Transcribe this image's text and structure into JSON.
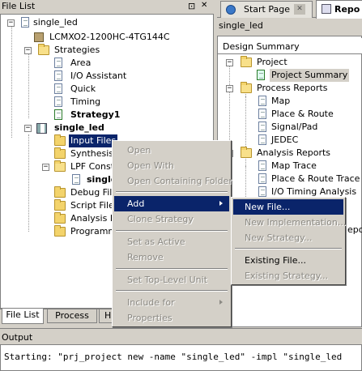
{
  "file_list": {
    "title": "File List",
    "pin_glyph": "⊡",
    "close_glyph": "✕",
    "project": "single_led",
    "device": "LCMXO2-1200HC-4TG144C",
    "strategies_label": "Strategies",
    "strategies": [
      "Area",
      "I/O Assistant",
      "Quick",
      "Timing",
      "Strategy1"
    ],
    "implementation": "single_led",
    "impl_items": [
      "Input Files",
      "Synthesis C",
      "LPF Constr",
      "Debug File",
      "Script Files",
      "Analysis Fi",
      "Programmi"
    ],
    "lpf_child": "single",
    "bottom_tabs": [
      "File List",
      "Process",
      "H"
    ]
  },
  "right_panel": {
    "tabs": [
      "Start Page",
      "Repo"
    ],
    "tab_close": "✕",
    "path": "single_led",
    "header": "Design Summary",
    "tree": [
      {
        "label": "Project",
        "type": "folder"
      },
      {
        "label": "Project Summary",
        "type": "doc"
      },
      {
        "label": "Process Reports",
        "type": "folder"
      },
      {
        "label": "Map",
        "type": "doc"
      },
      {
        "label": "Place & Route",
        "type": "doc"
      },
      {
        "label": "Signal/Pad",
        "type": "doc"
      },
      {
        "label": "JEDEC",
        "type": "doc"
      },
      {
        "label": "Analysis Reports",
        "type": "folder"
      },
      {
        "label": "Map Trace",
        "type": "doc"
      },
      {
        "label": "Place & Route Trace",
        "type": "doc"
      },
      {
        "label": "I/O Timing Analysis",
        "type": "doc"
      }
    ],
    "clipped_text": "epo"
  },
  "context_menu": {
    "items": [
      "Open",
      "Open With",
      "Open Containing Folder",
      "Add",
      "Clone Strategy",
      "Set as Active",
      "Remove",
      "Set Top-Level Unit",
      "Include for",
      "Properties"
    ]
  },
  "submenu": {
    "items": [
      "New File...",
      "New Implementation...",
      "New Strategy...",
      "Existing File...",
      "Existing Strategy..."
    ]
  },
  "output": {
    "title": "Output",
    "text": "Starting: \"prj_project new -name \"single_led\" -impl \"single_led"
  },
  "colors": {
    "highlight": "#0a246a",
    "panel": "#d4d0c8"
  }
}
